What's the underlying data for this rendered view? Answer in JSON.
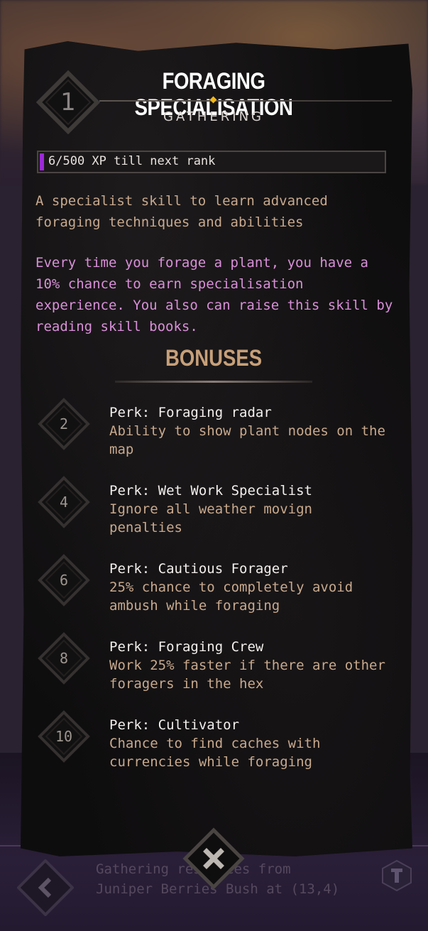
{
  "header": {
    "rank": "1",
    "title": "FORAGING SPECIALISATION",
    "subtitle": "GATHERING"
  },
  "xp": {
    "label": "6/500 XP till next rank",
    "progress": 0.012,
    "fill_color": "#9b29d8"
  },
  "description": "A specialist skill to learn advanced foraging techniques and abilities",
  "info": "Every time you forage a plant, you have a 10% chance to earn specialisation experience. You also can raise this skill by reading skill books.",
  "bonuses": {
    "heading": "BONUSES",
    "perks": [
      {
        "level": "2",
        "name": "Perk: Foraging radar",
        "desc": "Ability to show plant nodes on the map"
      },
      {
        "level": "4",
        "name": "Perk: Wet Work Specialist",
        "desc": "Ignore all weather movign penalties"
      },
      {
        "level": "6",
        "name": "Perk: Cautious Forager",
        "desc": "25% chance to completely avoid ambush while foraging"
      },
      {
        "level": "8",
        "name": "Perk: Foraging Crew",
        "desc": "Work 25% faster if there are other foragers in the hex"
      },
      {
        "level": "10",
        "name": "Perk: Cultivator",
        "desc": "Chance to find caches with currencies while foraging"
      }
    ]
  },
  "background": {
    "log_text": "Gathering resources from Juniper Berries Bush at (13,4)"
  },
  "icons": {
    "close": "close-icon",
    "back": "chevron-left-icon",
    "side": "tool-icon"
  },
  "colors": {
    "accent_gold": "#f0b81c",
    "text_tan": "#c8a98d",
    "text_pink": "#d990d9",
    "heading_tan": "#c7a079"
  }
}
